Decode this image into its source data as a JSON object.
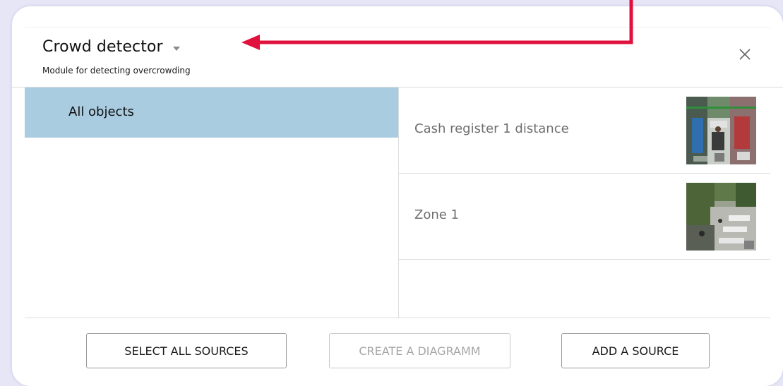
{
  "header": {
    "title": "Crowd detector",
    "subtitle": "Module for detecting overcrowding"
  },
  "objects": [
    {
      "label": "All objects",
      "selected": true
    }
  ],
  "sources": [
    {
      "label": "Cash register 1 distance",
      "thumb_icon": "store-camera-thumbnail"
    },
    {
      "label": "Zone 1",
      "thumb_icon": "park-camera-thumbnail"
    }
  ],
  "footer": {
    "select_all_label": "SELECT ALL SOURCES",
    "create_diagram_label": "CREATE A DIAGRAMM",
    "add_source_label": "ADD A SOURCE"
  },
  "colors": {
    "selected_row": "#a9cce1",
    "annotation_arrow": "#e0123d",
    "background": "#e6e6f7"
  }
}
